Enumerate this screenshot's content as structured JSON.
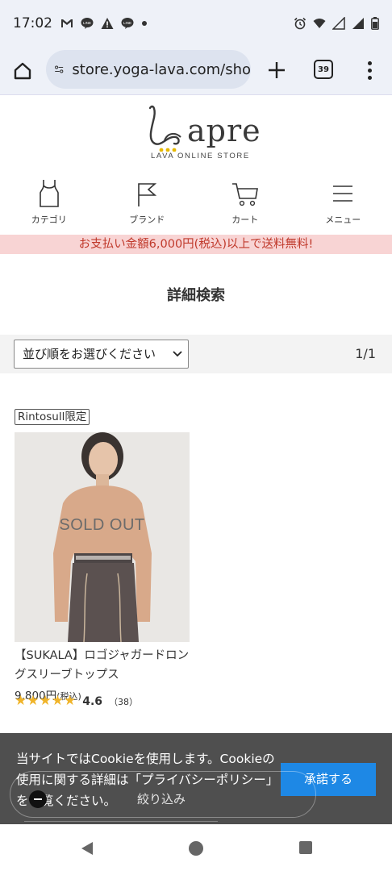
{
  "status_bar": {
    "time": "17:02",
    "left_icons": [
      "gmail-icon",
      "line-icon",
      "warning-icon",
      "line-icon",
      "dot-icon"
    ],
    "right_icons": [
      "alarm-icon",
      "wifi-icon",
      "signal-icon",
      "signal-icon",
      "battery-icon"
    ]
  },
  "browser": {
    "url": "store.yoga-lava.com/sho",
    "tab_count": "39"
  },
  "header": {
    "logo_text": "apre",
    "logo_sub": "LAVA ONLINE STORE"
  },
  "nav": [
    {
      "label": "カテゴリ",
      "icon": "tank-top-icon"
    },
    {
      "label": "ブランド",
      "icon": "flag-icon"
    },
    {
      "label": "カート",
      "icon": "cart-icon"
    },
    {
      "label": "メニュー",
      "icon": "hamburger-icon"
    }
  ],
  "banner": "お支払い金額6,000円(税込)以上で送料無料!",
  "page_title": "詳細検索",
  "sort": {
    "selected": "並び順をお選びください",
    "page_count": "1/1"
  },
  "product": {
    "badge": "Rintosull限定",
    "overlay": "SOLD OUT",
    "name": "【SUKALA】ロゴジャガードロングスリーブトップス",
    "price": "9,800円",
    "price_tax": "(税込)",
    "rating": "4.6",
    "rating_value": 4.6,
    "review_count": "（38）"
  },
  "cookie": {
    "text": "当サイトではCookieを使用します。Cookieの使用に関する詳細は「プライバシーポリシー」をご覧ください。",
    "accept_label": "承諾する",
    "filter_label": "絞り込み"
  },
  "colors": {
    "banner_bg": "#f8d4d4",
    "banner_text": "#c0392b",
    "accept_button": "#1e88e5",
    "star": "#f0b429"
  }
}
